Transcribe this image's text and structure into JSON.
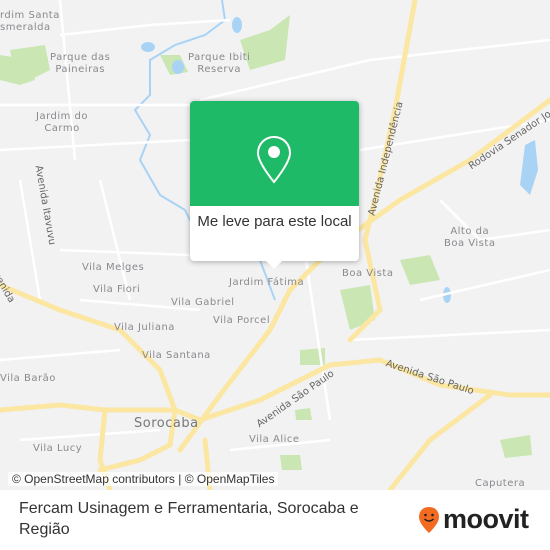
{
  "map": {
    "places": [
      {
        "name": "Jardim Santa Esmeralda",
        "line1": "rdim Santa",
        "line2": "smeralda"
      },
      {
        "name": "Parque das Paineiras",
        "line1": "Parque das",
        "line2": "Paineiras"
      },
      {
        "name": "Parque Ibiti Reserva",
        "line1": "Parque Ibiti",
        "line2": "Reserva"
      },
      {
        "name": "Jardim do Carmo",
        "line1": "Jardim do",
        "line2": "Carmo"
      },
      {
        "name": "Alto da Boa Vista",
        "line1": "Alto da",
        "line2": "Boa Vista"
      },
      {
        "name": "Boa Vista",
        "line1": "Boa Vista"
      },
      {
        "name": "Jardim Fátima",
        "line1": "Jardim Fátima"
      },
      {
        "name": "Vila Melges",
        "line1": "Vila Melges"
      },
      {
        "name": "Vila Fiori",
        "line1": "Vila Fiori"
      },
      {
        "name": "Vila Gabriel",
        "line1": "Vila Gabriel"
      },
      {
        "name": "Vila Porcel",
        "line1": "Vila Porcel"
      },
      {
        "name": "Vila Juliana",
        "line1": "Vila Juliana"
      },
      {
        "name": "Vila Santana",
        "line1": "Vila Santana"
      },
      {
        "name": "Vila Barão",
        "line1": "Vila Barão"
      },
      {
        "name": "Vila Lucy",
        "line1": "Vila Lucy"
      },
      {
        "name": "Vila Alice",
        "line1": "Vila Alice"
      },
      {
        "name": "Caputera",
        "line1": "Caputera"
      },
      {
        "name": "Sorocaba",
        "line1": "Sorocaba"
      }
    ],
    "roads": {
      "av_itavuvu": "Avenida Itavuvu",
      "av_independencia": "Avenida Independência",
      "rod_senador": "Rodovia Senador Jo",
      "av_sao_paulo_1": "Avenida São Paulo",
      "av_sao_paulo_2": "Avenida São Paulo",
      "edge_left": "Avenida"
    },
    "colors": {
      "road_major": "#fbe6a2",
      "water": "#a9d3f5",
      "park": "#c9e6b3",
      "background": "#f2f2f3"
    }
  },
  "popup": {
    "icon": "map-pin-icon",
    "label": "Me leve para este local",
    "color": "#1fba67"
  },
  "attribution": "© OpenStreetMap contributors | © OpenMapTiles",
  "footer": {
    "title": "Fercam Usinagem e Ferramentaria, Sorocaba e Região",
    "logo_text": "moovit",
    "logo_color": "#f26b21"
  }
}
